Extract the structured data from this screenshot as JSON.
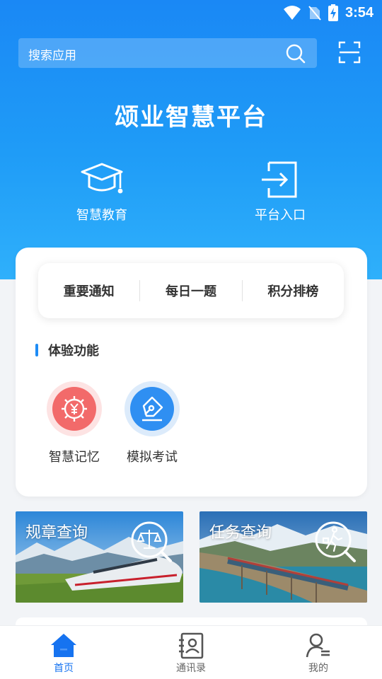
{
  "status_bar": {
    "time": "3:54"
  },
  "search": {
    "placeholder": "搜索应用"
  },
  "header": {
    "title": "颂业智慧平台"
  },
  "quick_entries": [
    {
      "label": "智慧教育",
      "icon": "graduation-cap-icon"
    },
    {
      "label": "平台入口",
      "icon": "login-icon"
    }
  ],
  "tabs": [
    {
      "label": "重要通知"
    },
    {
      "label": "每日一题"
    },
    {
      "label": "积分排榜"
    }
  ],
  "section": {
    "title": "体验功能"
  },
  "features": [
    {
      "label": "智慧记忆",
      "icon": "gear-yuan-icon",
      "color": "#f26a6a"
    },
    {
      "label": "模拟考试",
      "icon": "pen-icon",
      "color": "#2f8ff2"
    }
  ],
  "banners": [
    {
      "title": "规章查询",
      "icon": "scale-search-icon"
    },
    {
      "title": "任务查询",
      "icon": "walker-search-icon"
    }
  ],
  "bottom_nav": [
    {
      "label": "首页",
      "icon": "home-icon",
      "active": true
    },
    {
      "label": "通讯录",
      "icon": "contacts-icon",
      "active": false
    },
    {
      "label": "我的",
      "icon": "profile-icon",
      "active": false
    }
  ],
  "colors": {
    "primary": "#1a88f5",
    "accent": "#1673f0",
    "memory": "#f26a6a",
    "exam": "#2f8ff2"
  }
}
